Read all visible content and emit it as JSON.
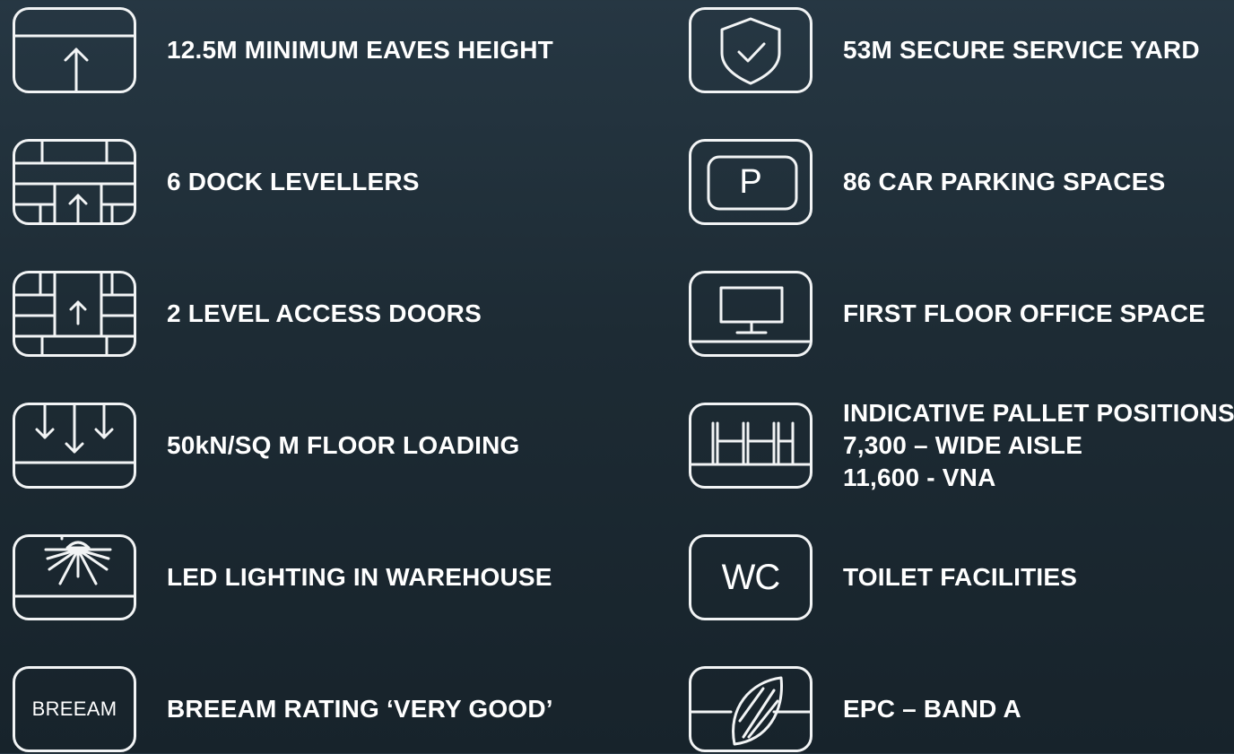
{
  "colors": {
    "background_top": "#263743",
    "background_bottom": "#17232b",
    "icon_stroke": "#f2f4f5",
    "text": "#ffffff"
  },
  "left_features": [
    {
      "icon": "eaves-height-arrow-icon",
      "label": "12.5M MINIMUM EAVES HEIGHT"
    },
    {
      "icon": "dock-leveller-icon",
      "label": "6 DOCK LEVELLERS"
    },
    {
      "icon": "level-access-door-icon",
      "label": "2 LEVEL ACCESS DOORS"
    },
    {
      "icon": "floor-loading-arrows-icon",
      "label": "50kN/SQ M FLOOR LOADING"
    },
    {
      "icon": "led-light-icon",
      "label": "LED LIGHTING IN WAREHOUSE"
    },
    {
      "icon": "breeam-icon",
      "icon_text": "BREEAM",
      "label": "BREEAM RATING ‘VERY GOOD’"
    }
  ],
  "right_features": [
    {
      "icon": "shield-check-icon",
      "label": "53M SECURE SERVICE YARD"
    },
    {
      "icon": "parking-icon",
      "icon_text": "P",
      "label": "86 CAR PARKING SPACES"
    },
    {
      "icon": "monitor-desk-icon",
      "label": "FIRST FLOOR OFFICE SPACE"
    },
    {
      "icon": "pallet-racking-icon",
      "lines": [
        "INDICATIVE PALLET POSITIONS",
        "7,300 – WIDE AISLE",
        "11,600 - VNA"
      ]
    },
    {
      "icon": "wc-icon",
      "icon_text": "WC",
      "label": "TOILET FACILITIES"
    },
    {
      "icon": "leaf-icon",
      "label": "EPC – BAND A"
    }
  ]
}
